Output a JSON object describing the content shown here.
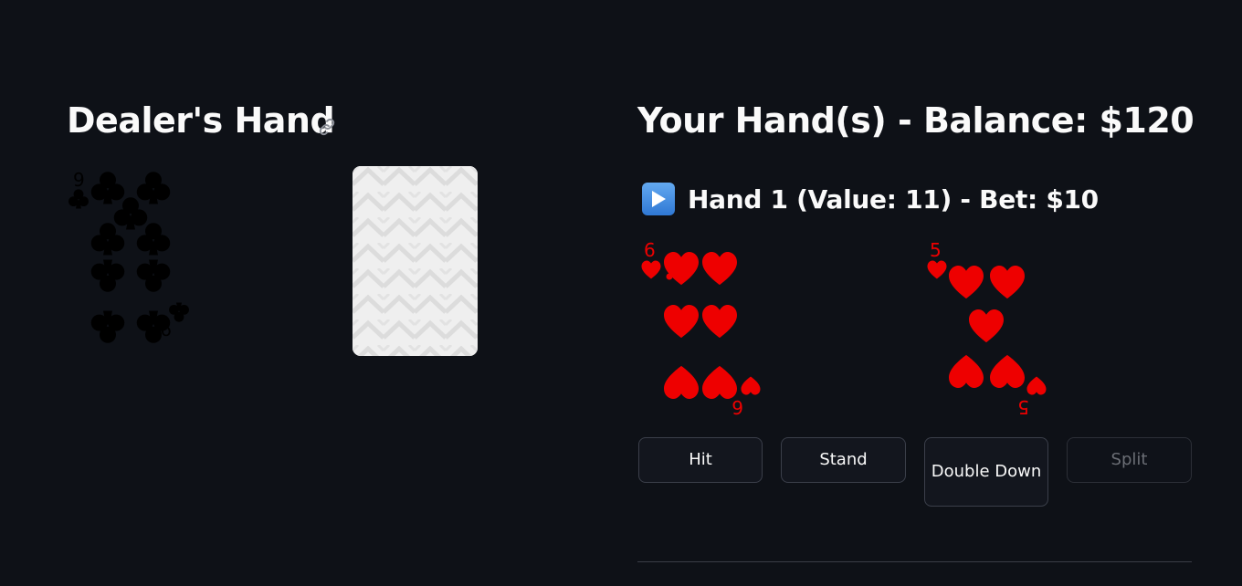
{
  "dealer": {
    "title": "Dealer's Hand",
    "link_icon": "link-icon",
    "cards": [
      {
        "rank": "9",
        "suit": "clubs",
        "face_up": true
      },
      {
        "rank": "",
        "suit": "",
        "face_up": false
      }
    ]
  },
  "player": {
    "title": "Your Hand(s) - Balance: $120",
    "balance": 120,
    "hands": [
      {
        "icon": "play-button-icon",
        "label": "Hand 1 (Value: 11) - Bet: $10",
        "value": 11,
        "bet": 10,
        "cards": [
          {
            "rank": "6",
            "suit": "hearts",
            "face_up": true
          },
          {
            "rank": "5",
            "suit": "hearts",
            "face_up": true
          }
        ]
      }
    ],
    "actions": {
      "hit": "Hit",
      "stand": "Stand",
      "double_down": "Double Down",
      "split": "Split"
    }
  },
  "colors": {
    "background": "#0e1117",
    "text": "#fafafa",
    "red_suit": "#ee0000",
    "black_suit": "#000000",
    "disabled_text": "#6b6e75"
  }
}
